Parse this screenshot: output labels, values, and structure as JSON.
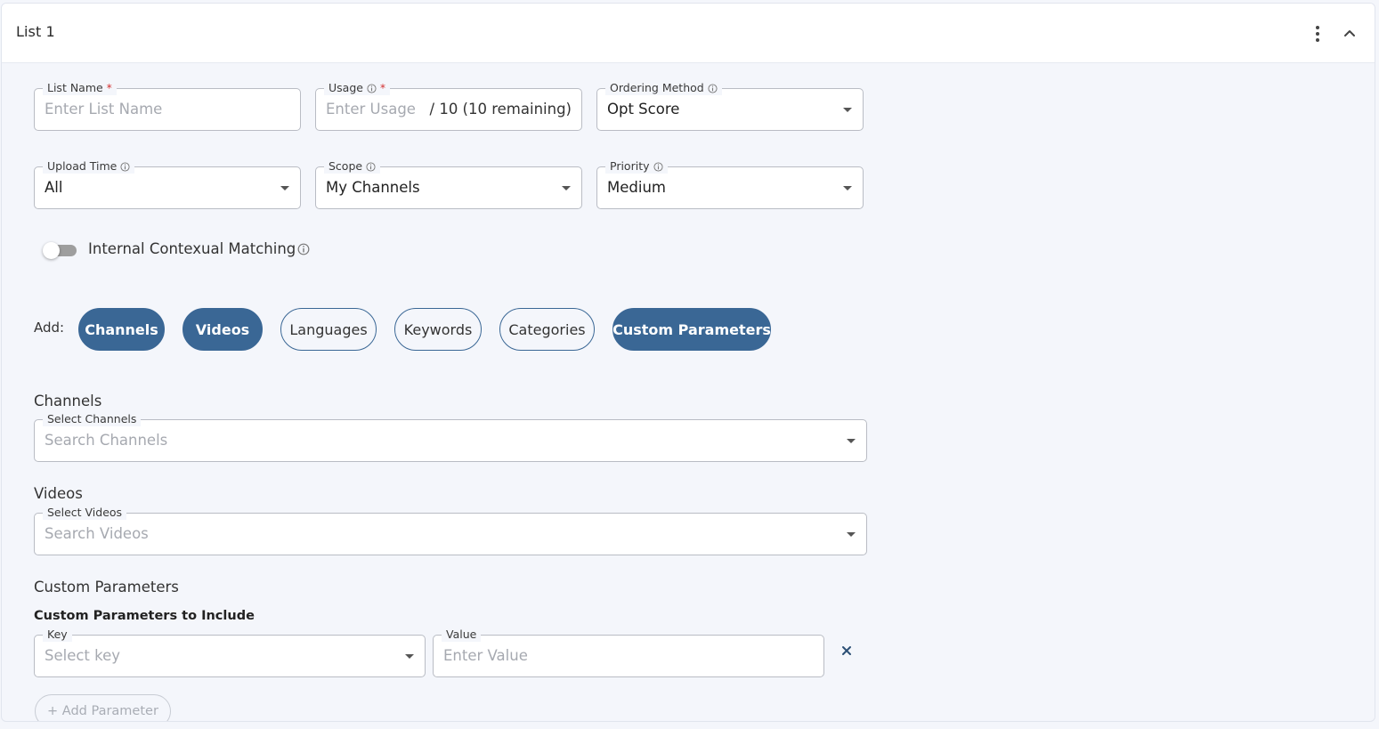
{
  "header": {
    "title": "List 1"
  },
  "fields": {
    "list_name": {
      "label": "List Name",
      "required_mark": "*",
      "placeholder": "Enter List Name"
    },
    "usage": {
      "label": "Usage",
      "required_mark": "*",
      "placeholder": "Enter Usage",
      "suffix": "/ 10 (10 remaining)"
    },
    "ordering_method": {
      "label": "Ordering Method",
      "value": "Opt Score"
    },
    "upload_time": {
      "label": "Upload Time",
      "value": "All"
    },
    "scope": {
      "label": "Scope",
      "value": "My Channels"
    },
    "priority": {
      "label": "Priority",
      "value": "Medium"
    }
  },
  "toggle": {
    "label": "Internal Contexual Matching",
    "enabled": false
  },
  "add": {
    "label": "Add:",
    "chips": [
      {
        "label": "Channels",
        "active": true
      },
      {
        "label": "Videos",
        "active": true
      },
      {
        "label": "Languages",
        "active": false
      },
      {
        "label": "Keywords",
        "active": false
      },
      {
        "label": "Categories",
        "active": false
      },
      {
        "label": "Custom Parameters",
        "active": true
      }
    ]
  },
  "channels": {
    "title": "Channels",
    "label": "Select Channels",
    "placeholder": "Search Channels"
  },
  "videos": {
    "title": "Videos",
    "label": "Select Videos",
    "placeholder": "Search Videos"
  },
  "custom_parameters": {
    "title": "Custom Parameters",
    "subtitle": "Custom Parameters to Include",
    "key": {
      "label": "Key",
      "placeholder": "Select key"
    },
    "value": {
      "label": "Value",
      "placeholder": "Enter Value"
    },
    "add_button": "+ Add Parameter"
  },
  "colors": {
    "accent": "#3a6795",
    "required": "#d32f2f",
    "background": "#f4f6fb"
  },
  "icons": [
    "more-vertical-icon",
    "chevron-up-icon",
    "info-icon",
    "caret-down-icon",
    "close-icon"
  ]
}
